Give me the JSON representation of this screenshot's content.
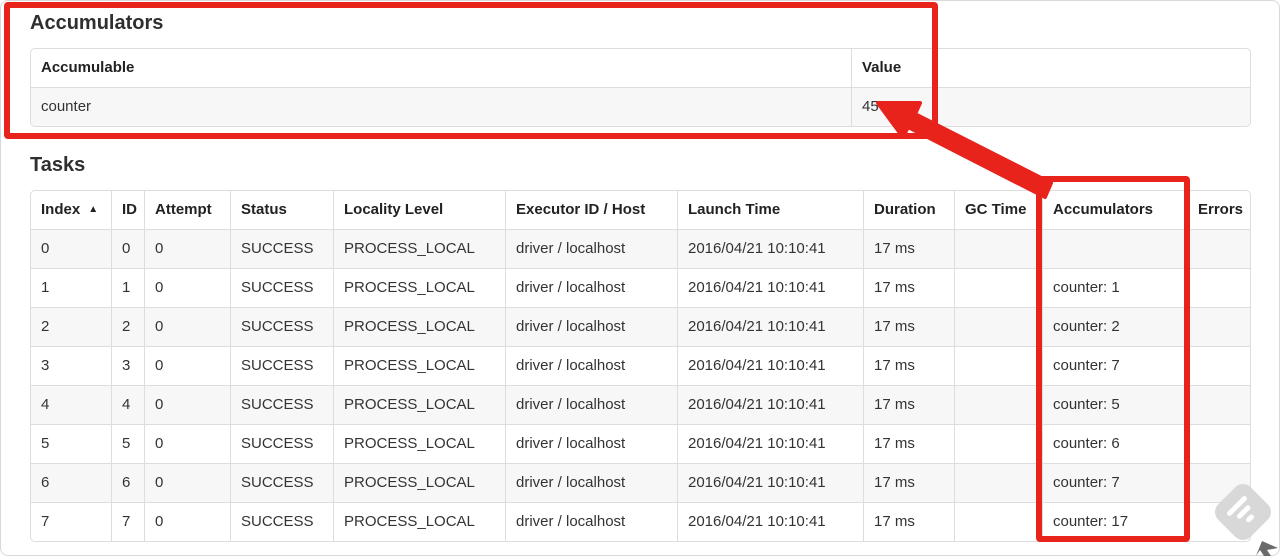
{
  "accumulators": {
    "title": "Accumulators",
    "columns": [
      "Accumulable",
      "Value"
    ],
    "rows": [
      [
        "counter",
        "45"
      ]
    ]
  },
  "tasks": {
    "title": "Tasks",
    "sort": {
      "column": "Index",
      "direction": "asc",
      "glyph": "▲"
    },
    "columns": [
      "Index",
      "ID",
      "Attempt",
      "Status",
      "Locality Level",
      "Executor ID / Host",
      "Launch Time",
      "Duration",
      "GC Time",
      "Accumulators",
      "Errors"
    ],
    "rows": [
      [
        "0",
        "0",
        "0",
        "SUCCESS",
        "PROCESS_LOCAL",
        "driver / localhost",
        "2016/04/21 10:10:41",
        "17 ms",
        "",
        "",
        ""
      ],
      [
        "1",
        "1",
        "0",
        "SUCCESS",
        "PROCESS_LOCAL",
        "driver / localhost",
        "2016/04/21 10:10:41",
        "17 ms",
        "",
        "counter: 1",
        ""
      ],
      [
        "2",
        "2",
        "0",
        "SUCCESS",
        "PROCESS_LOCAL",
        "driver / localhost",
        "2016/04/21 10:10:41",
        "17 ms",
        "",
        "counter: 2",
        ""
      ],
      [
        "3",
        "3",
        "0",
        "SUCCESS",
        "PROCESS_LOCAL",
        "driver / localhost",
        "2016/04/21 10:10:41",
        "17 ms",
        "",
        "counter: 7",
        ""
      ],
      [
        "4",
        "4",
        "0",
        "SUCCESS",
        "PROCESS_LOCAL",
        "driver / localhost",
        "2016/04/21 10:10:41",
        "17 ms",
        "",
        "counter: 5",
        ""
      ],
      [
        "5",
        "5",
        "0",
        "SUCCESS",
        "PROCESS_LOCAL",
        "driver / localhost",
        "2016/04/21 10:10:41",
        "17 ms",
        "",
        "counter: 6",
        ""
      ],
      [
        "6",
        "6",
        "0",
        "SUCCESS",
        "PROCESS_LOCAL",
        "driver / localhost",
        "2016/04/21 10:10:41",
        "17 ms",
        "",
        "counter: 7",
        ""
      ],
      [
        "7",
        "7",
        "0",
        "SUCCESS",
        "PROCESS_LOCAL",
        "driver / localhost",
        "2016/04/21 10:10:41",
        "17 ms",
        "",
        "counter: 17",
        ""
      ]
    ]
  },
  "annotations": {
    "color": "#e8231c",
    "boxes": [
      "accumulators-summary",
      "accumulators-column"
    ],
    "arrow_points_to": "45"
  }
}
